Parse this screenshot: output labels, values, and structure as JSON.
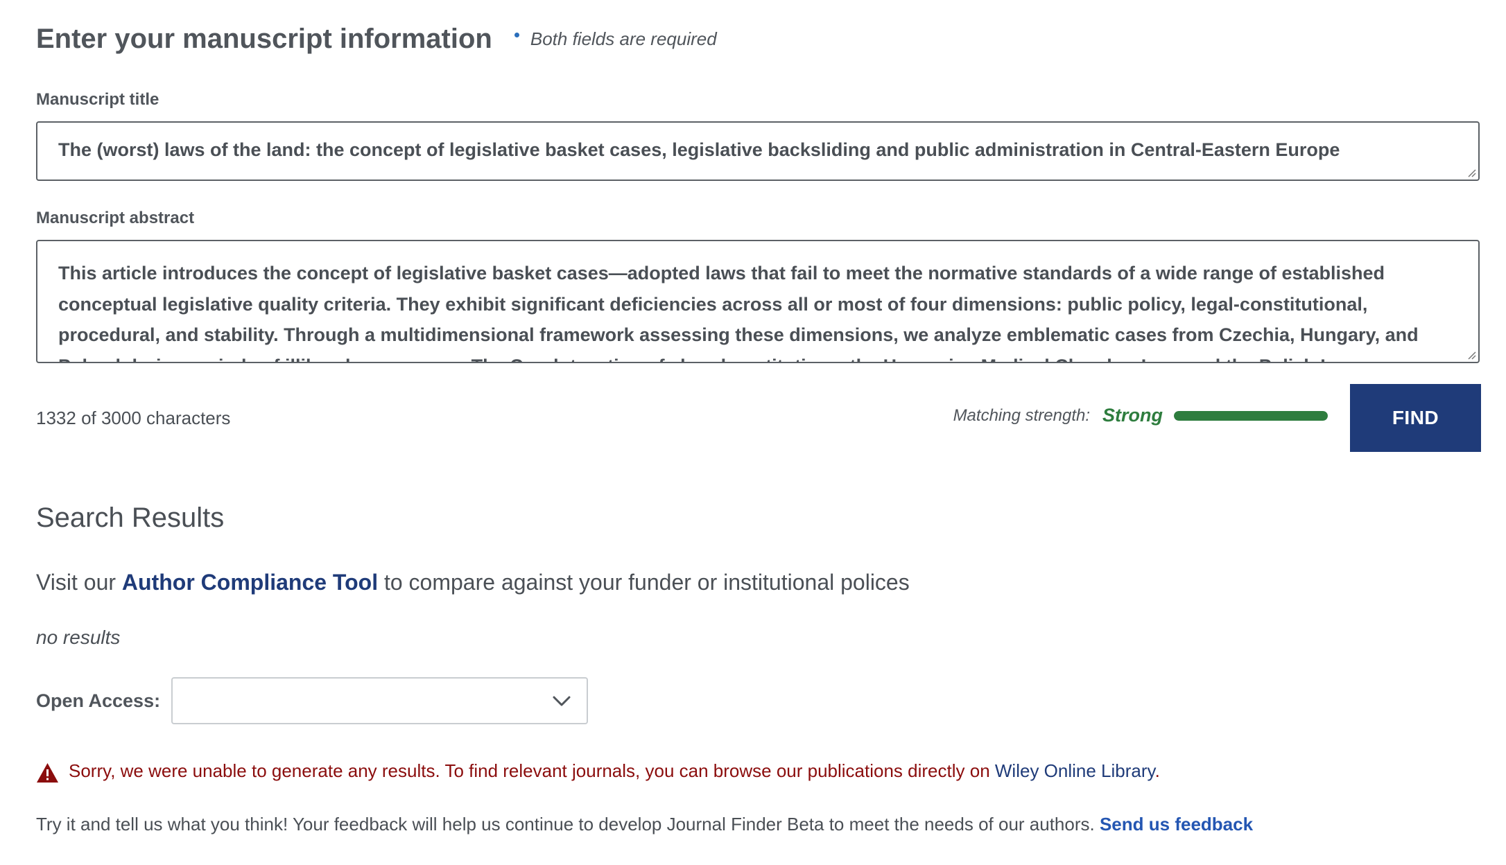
{
  "form": {
    "heading": "Enter your manuscript information",
    "required_note": "Both fields are required",
    "title_label": "Manuscript title",
    "title_value": "The (worst) laws of the land: the concept of legislative basket cases, legislative backsliding and public administration in Central-Eastern Europe",
    "abstract_label": "Manuscript abstract",
    "abstract_value": "This article introduces the concept of legislative basket cases—adopted laws that fail to meet the normative standards of a wide range of established conceptual legislative quality criteria. They exhibit significant deficiencies across all or most of four dimensions: public policy, legal-constitutional, procedural, and stability. Through a multidimensional framework assessing these dimensions, we analyze emblematic cases from Czechia, Hungary, and Poland during periods of illiberal governance. The Czech taxation of church restitutions, the Hungarian Medical Chamber Law, and the Polish Law",
    "char_count": "1332 of 3000 characters",
    "strength_label": "Matching strength:",
    "strength_value": "Strong",
    "strength_level": 1.0,
    "strength_color": "#2e7d3e",
    "find_label": "FIND"
  },
  "results": {
    "heading": "Search Results",
    "visit_prefix": "Visit our",
    "visit_link": "Author Compliance Tool",
    "visit_suffix": "to compare against your funder or institutional polices",
    "no_results": "no results",
    "open_access_label": "Open Access:",
    "open_access_value": "",
    "error_text": "Sorry, we were unable to generate any results. To find relevant journals, you can browse our publications directly on",
    "error_link": "Wiley Online Library",
    "error_end": ".",
    "feedback_text": "Try it and tell us what you think! Your feedback will help us continue to develop Journal Finder Beta to meet the needs of our authors.",
    "feedback_link": "Send us feedback"
  },
  "icons": {
    "required": "dot-icon",
    "select": "chevron-down-icon",
    "error": "warning-icon"
  },
  "colors": {
    "brand": "#1f3b79",
    "error": "#8b0d0d",
    "link": "#2456b2"
  }
}
